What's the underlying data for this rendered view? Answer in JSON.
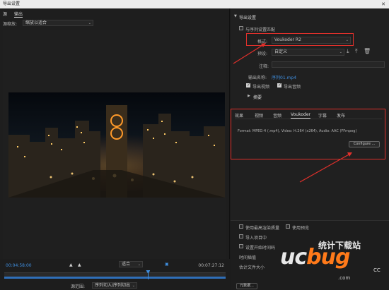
{
  "window": {
    "title": "导出设置",
    "close_glyph": "✕"
  },
  "left_panel": {
    "tabs": [
      "源",
      "输出"
    ],
    "active_tab": "输出",
    "source_scaling": {
      "label": "源缩放:",
      "value": "缩放以适合"
    },
    "timeline": {
      "current_timecode": "00:04:58:00",
      "end_timecode": "00:07:27:12",
      "fit_value": "适合",
      "range_label": "源范围:",
      "range_value": "序列切入/序列切出",
      "playhead_fraction": 0.65
    }
  },
  "export_settings": {
    "section_title": "导出设置",
    "match_sequence_label": "与序列设置匹配",
    "format_label": "格式:",
    "format_value": "Voukoder R2",
    "preset_label": "预设:",
    "preset_value": "自定义",
    "comment_label": "注释:",
    "output_name_label": "输出名称:",
    "output_name_value": "序列01.mp4",
    "export_video_label": "导出视频",
    "export_audio_label": "导出音频",
    "summary_label": "摘要"
  },
  "settings_tabs": {
    "tabs": [
      "效果",
      "视频",
      "音频",
      "Voukoder",
      "字幕",
      "发布"
    ],
    "active": "Voukoder",
    "format_line": "Format:     MPEG-4 (.mp4), Video: H.264 (x264), Audio: AAC (FFmpeg)",
    "configure_label": "Configure ..."
  },
  "bottom_options": {
    "max_depth_label": "使用最高渲染质量",
    "use_preview_label": "使用预览",
    "import_label": "导入项目中",
    "set_start_label": "设置开始时间码",
    "interp_label": "时间插值",
    "filesize_label": "估计文件大小",
    "metadata_label": "元数据..."
  },
  "watermark": {
    "brand_cn": "统计下载站",
    "logo_text_1": "uc",
    "logo_text_2": "bug",
    "url": ".com",
    "suffix": "CC"
  },
  "colors": {
    "accent_blue": "#3f8fe0",
    "annotation_red": "#e0302b"
  }
}
